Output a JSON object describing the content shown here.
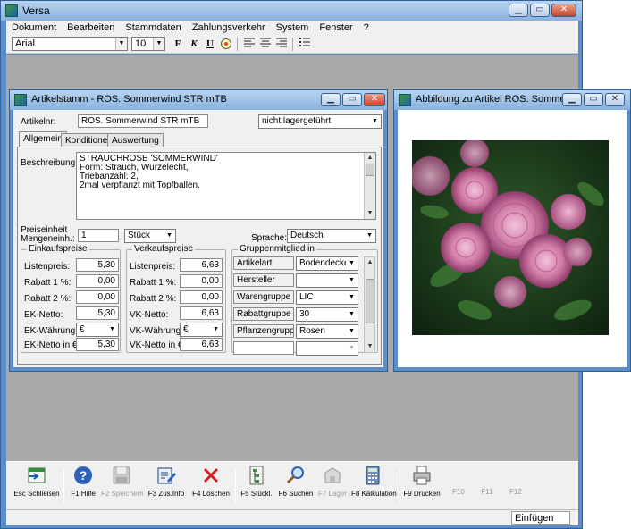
{
  "app": {
    "title": "Versa"
  },
  "menu": [
    "Dokument",
    "Bearbeiten",
    "Stammdaten",
    "Zahlungsverkehr",
    "System",
    "Fenster",
    "?"
  ],
  "format": {
    "font": "Arial",
    "size": "10",
    "bold": "F",
    "italic": "K",
    "underline": "U"
  },
  "article_window": {
    "title": "Artikelstamm - ROS. Sommerwind STR mTB",
    "artikelnr_label": "Artikelnr:",
    "artikelnr": "ROS. Sommerwind STR mTB",
    "lager": "nicht lagergeführt",
    "tabs": [
      "Allgemein",
      "Konditionen",
      "Auswertung"
    ],
    "beschreibung_label": "Beschreibung:",
    "beschreibung": [
      "STRAUCHROSE 'SOMMERWIND'",
      "Form: Strauch, Wurzelecht,",
      "Triebanzahl: 2,",
      "2mal verpflanzt mit Topfballen."
    ],
    "preiseinheit_label": "Preiseinheit",
    "mengeneinh_label": "Mengeneinh.:",
    "mengeneinh": "1",
    "einheit": "Stück",
    "sprache_label": "Sprache:",
    "sprache": "Deutsch",
    "einkauf": {
      "title": "Einkaufspreise",
      "rows": [
        {
          "label": "Listenpreis:",
          "value": "5,30"
        },
        {
          "label": "Rabatt 1 %:",
          "value": "0,00"
        },
        {
          "label": "Rabatt 2 %:",
          "value": "0,00"
        },
        {
          "label": "EK-Netto:",
          "value": "5,30"
        },
        {
          "label": "EK-Währung:",
          "value": "€"
        },
        {
          "label": "EK-Netto in €:",
          "value": "5,30"
        }
      ]
    },
    "verkauf": {
      "title": "Verkaufspreise",
      "rows": [
        {
          "label": "Listenpreis:",
          "value": "6,63"
        },
        {
          "label": "Rabatt 1 %:",
          "value": "0,00"
        },
        {
          "label": "Rabatt 2 %:",
          "value": "0,00"
        },
        {
          "label": "VK-Netto:",
          "value": "6,63"
        },
        {
          "label": "VK-Währung:",
          "value": "€"
        },
        {
          "label": "VK-Netto in €:",
          "value": "6,63"
        }
      ]
    },
    "gruppen": {
      "title": "Gruppenmitglied in",
      "rows": [
        {
          "label": "Artikelart",
          "value": "Bodendecker"
        },
        {
          "label": "Hersteller",
          "value": ""
        },
        {
          "label": "Warengruppe",
          "value": "LIC"
        },
        {
          "label": "Rabattgruppe",
          "value": "30"
        },
        {
          "label": "Pflanzengruppe",
          "value": "Rosen"
        },
        {
          "label": "",
          "value": ""
        }
      ]
    }
  },
  "image_window": {
    "title": "Abbildung zu Artikel ROS. Sommerwind"
  },
  "fkeys": [
    {
      "label": "Esc Schließen",
      "icon": "close-window-icon",
      "enabled": true
    },
    {
      "label": "F1 Hilfe",
      "icon": "help-icon",
      "enabled": true
    },
    {
      "label": "F2 Speichern",
      "icon": "save-icon",
      "enabled": false
    },
    {
      "label": "F3 Zus.Info",
      "icon": "info-edit-icon",
      "enabled": true
    },
    {
      "label": "F4 Löschen",
      "icon": "delete-icon",
      "enabled": true
    },
    {
      "label": "F5 Stückl.",
      "icon": "tree-icon",
      "enabled": true
    },
    {
      "label": "F6 Suchen",
      "icon": "search-icon",
      "enabled": true
    },
    {
      "label": "F7 Lager",
      "icon": "warehouse-icon",
      "enabled": false
    },
    {
      "label": "F8 Kalkulation",
      "icon": "calculator-icon",
      "enabled": true
    },
    {
      "label": "F9 Drucken",
      "icon": "printer-icon",
      "enabled": true
    },
    {
      "label": "F10",
      "icon": "",
      "enabled": false
    },
    {
      "label": "F11",
      "icon": "",
      "enabled": false
    },
    {
      "label": "F12",
      "icon": "",
      "enabled": false
    }
  ],
  "status": {
    "mode": "Einfügen"
  },
  "colors": {
    "titlebar": "#88b2de",
    "workspace": "#a9a9a9",
    "accent": "#5a8fc9"
  }
}
